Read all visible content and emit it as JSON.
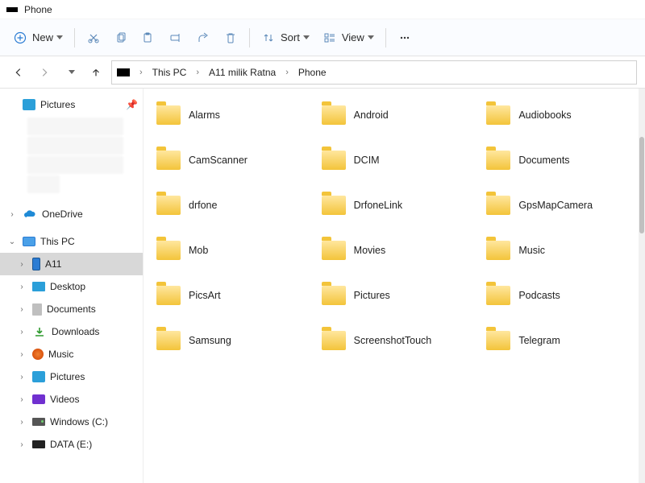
{
  "title": "Phone",
  "toolbar": {
    "new": "New",
    "sort": "Sort",
    "view": "View"
  },
  "breadcrumb": [
    "This PC",
    "A11 milik Ratna",
    "Phone"
  ],
  "sidebar": {
    "pictures": "Pictures",
    "onedrive": "OneDrive",
    "thispc": "This PC",
    "a11": "A11",
    "desktop": "Desktop",
    "documents": "Documents",
    "downloads": "Downloads",
    "music": "Music",
    "picsub": "Pictures",
    "videos": "Videos",
    "cdrive": "Windows (C:)",
    "ddrive": "DATA (E:)"
  },
  "folders": [
    "Alarms",
    "Android",
    "Audiobooks",
    "CamScanner",
    "DCIM",
    "Documents",
    "drfone",
    "DrfoneLink",
    "GpsMapCamera",
    "Mob",
    "Movies",
    "Music",
    "PicsArt",
    "Pictures",
    "Podcasts",
    "Samsung",
    "ScreenshotTouch",
    "Telegram"
  ]
}
